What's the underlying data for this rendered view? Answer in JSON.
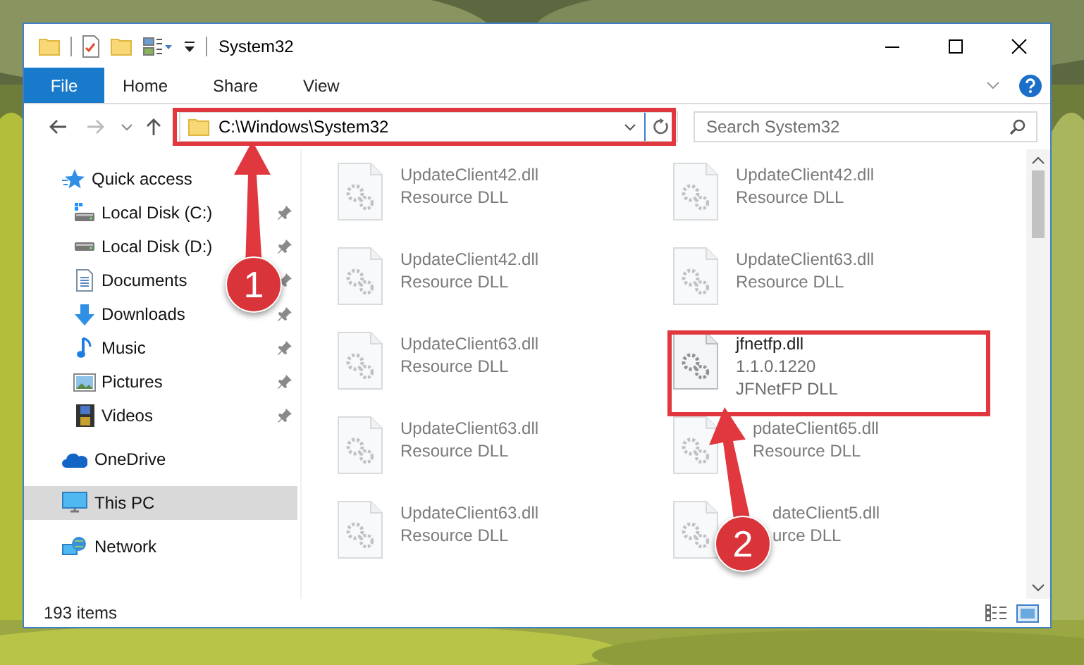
{
  "window": {
    "title": "System32"
  },
  "ribbon": {
    "tabs": [
      {
        "label": "File",
        "kind": "file"
      },
      {
        "label": "Home",
        "kind": "tab"
      },
      {
        "label": "Share",
        "kind": "tab"
      },
      {
        "label": "View",
        "kind": "tab"
      }
    ]
  },
  "address_bar": {
    "path": "C:\\Windows\\System32",
    "search": {
      "placeholder": "Search System32"
    }
  },
  "sidebar": {
    "items": [
      {
        "label": "Quick access",
        "selected": false,
        "children": [
          {
            "label": "Local Disk (C:)",
            "pinned": true,
            "selected": false
          },
          {
            "label": "Local Disk (D:)",
            "pinned": true,
            "selected": false
          },
          {
            "label": "Documents",
            "pinned": true,
            "selected": false
          },
          {
            "label": "Downloads",
            "pinned": true,
            "selected": false
          },
          {
            "label": "Music",
            "pinned": true,
            "selected": false
          },
          {
            "label": "Pictures",
            "pinned": true,
            "selected": false
          },
          {
            "label": "Videos",
            "pinned": true,
            "selected": false
          }
        ]
      },
      {
        "label": "OneDrive",
        "selected": false
      },
      {
        "label": "This PC",
        "selected": true
      },
      {
        "label": "Network",
        "selected": false
      }
    ]
  },
  "files": [
    {
      "name": "UpdateClient42.dll",
      "description": "Resource DLL",
      "blurred": true
    },
    {
      "name": "UpdateClient42.dll",
      "description": "Resource DLL",
      "blurred": true
    },
    {
      "name": "UpdateClient42.dll",
      "description": "Resource DLL",
      "blurred": true
    },
    {
      "name": "UpdateClient63.dll",
      "description": "Resource DLL",
      "blurred": true
    },
    {
      "name": "UpdateClient63.dll",
      "description": "Resource DLL",
      "blurred": true
    },
    {
      "name": "jfnetfp.dll",
      "version": "1.1.0.1220",
      "description": "JFNetFP DLL",
      "blurred": false
    },
    {
      "name": "UpdateClient63.dll",
      "description": "Resource DLL",
      "blurred": true
    },
    {
      "name": "pdateClient65.dll",
      "description": "Resource DLL",
      "blurred": true,
      "kind": "under_arrow"
    },
    {
      "name": "UpdateClient63.dll",
      "description": "Resource DLL",
      "blurred": true
    },
    {
      "name": "dateClient5.dll",
      "description": "urce DLL",
      "blurred": true,
      "kind": "under_badge"
    }
  ],
  "status_bar": {
    "item_count": "193 items"
  },
  "callouts": [
    {
      "number": "1"
    },
    {
      "number": "2"
    }
  ]
}
